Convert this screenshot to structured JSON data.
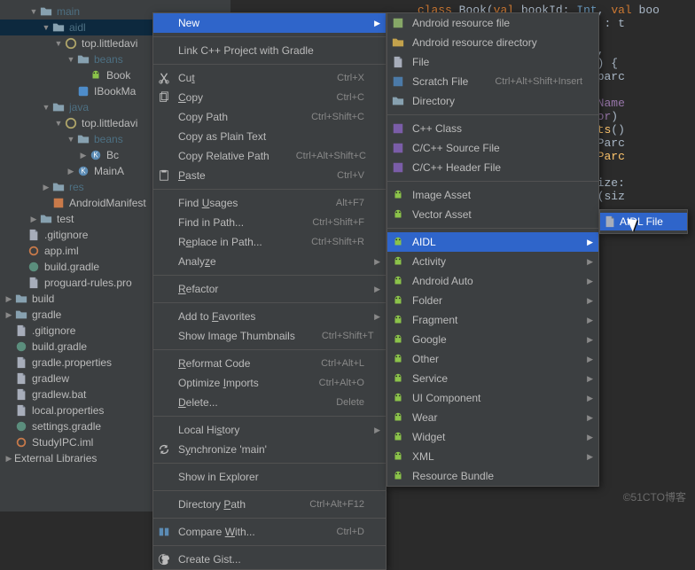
{
  "tree": {
    "items": [
      {
        "depth": 2,
        "chev": "down",
        "icon": "folder",
        "label": "main",
        "cls": "hl"
      },
      {
        "depth": 3,
        "chev": "down",
        "icon": "folder",
        "label": "aidl",
        "cls": "hl",
        "sel": true
      },
      {
        "depth": 4,
        "chev": "down",
        "icon": "package",
        "label": "top.littledavi"
      },
      {
        "depth": 5,
        "chev": "down",
        "icon": "folder",
        "label": "beans",
        "cls": "hl"
      },
      {
        "depth": 6,
        "chev": "",
        "icon": "android",
        "label": "Book"
      },
      {
        "depth": 5,
        "chev": "",
        "icon": "aidl",
        "label": "IBookMa"
      },
      {
        "depth": 3,
        "chev": "down",
        "icon": "folder",
        "label": "java",
        "cls": "hl"
      },
      {
        "depth": 4,
        "chev": "down",
        "icon": "package",
        "label": "top.littledavi"
      },
      {
        "depth": 5,
        "chev": "down",
        "icon": "folder",
        "label": "beans",
        "cls": "hl"
      },
      {
        "depth": 6,
        "chev": "right",
        "icon": "class",
        "label": "Bc"
      },
      {
        "depth": 5,
        "chev": "right",
        "icon": "class",
        "label": "MainA"
      },
      {
        "depth": 3,
        "chev": "right",
        "icon": "folder",
        "label": "res",
        "cls": "hl"
      },
      {
        "depth": 3,
        "chev": "",
        "icon": "manifest",
        "label": "AndroidManifest"
      },
      {
        "depth": 2,
        "chev": "right",
        "icon": "folder",
        "label": "test",
        "cls": ""
      },
      {
        "depth": 1,
        "chev": "",
        "icon": "file",
        "label": ".gitignore"
      },
      {
        "depth": 1,
        "chev": "",
        "icon": "ring",
        "label": "app.iml"
      },
      {
        "depth": 1,
        "chev": "",
        "icon": "gradle",
        "label": "build.gradle"
      },
      {
        "depth": 1,
        "chev": "",
        "icon": "file",
        "label": "proguard-rules.pro"
      },
      {
        "depth": 0,
        "chev": "right",
        "icon": "folder",
        "label": "build",
        "cls": ""
      },
      {
        "depth": 0,
        "chev": "right",
        "icon": "folder",
        "label": "gradle",
        "cls": ""
      },
      {
        "depth": 0,
        "chev": "",
        "icon": "file",
        "label": ".gitignore"
      },
      {
        "depth": 0,
        "chev": "",
        "icon": "gradle",
        "label": "build.gradle"
      },
      {
        "depth": 0,
        "chev": "",
        "icon": "file",
        "label": "gradle.properties"
      },
      {
        "depth": 0,
        "chev": "",
        "icon": "file",
        "label": "gradlew"
      },
      {
        "depth": 0,
        "chev": "",
        "icon": "file",
        "label": "gradlew.bat"
      },
      {
        "depth": 0,
        "chev": "",
        "icon": "file",
        "label": "local.properties"
      },
      {
        "depth": 0,
        "chev": "",
        "icon": "gradle",
        "label": "settings.gradle"
      },
      {
        "depth": 0,
        "chev": "",
        "icon": "ring",
        "label": "StudyIPC.iml"
      }
    ],
    "footer": "External Libraries"
  },
  "menu1": {
    "groups": [
      [
        {
          "label": "New",
          "sub": true,
          "hover": true
        }
      ],
      [
        {
          "label": "Link C++ Project with Gradle"
        }
      ],
      [
        {
          "icon": "cut",
          "label": "Cut",
          "shortcut": "Ctrl+X",
          "u": 2
        },
        {
          "icon": "copy",
          "label": "Copy",
          "shortcut": "Ctrl+C",
          "u": 0
        },
        {
          "label": "Copy Path",
          "shortcut": "Ctrl+Shift+C"
        },
        {
          "label": "Copy as Plain Text"
        },
        {
          "label": "Copy Relative Path",
          "shortcut": "Ctrl+Alt+Shift+C"
        },
        {
          "icon": "paste",
          "label": "Paste",
          "shortcut": "Ctrl+V",
          "u": 0
        }
      ],
      [
        {
          "label": "Find Usages",
          "shortcut": "Alt+F7",
          "u": 5
        },
        {
          "label": "Find in Path...",
          "shortcut": "Ctrl+Shift+F"
        },
        {
          "label": "Replace in Path...",
          "shortcut": "Ctrl+Shift+R",
          "u": 1
        },
        {
          "label": "Analyze",
          "sub": true,
          "u": 5
        }
      ],
      [
        {
          "label": "Refactor",
          "sub": true,
          "u": 0
        }
      ],
      [
        {
          "label": "Add to Favorites",
          "sub": true,
          "u": 7
        },
        {
          "label": "Show Image Thumbnails",
          "shortcut": "Ctrl+Shift+T"
        }
      ],
      [
        {
          "label": "Reformat Code",
          "shortcut": "Ctrl+Alt+L",
          "u": 0
        },
        {
          "label": "Optimize Imports",
          "shortcut": "Ctrl+Alt+O",
          "u": 9
        },
        {
          "label": "Delete...",
          "shortcut": "Delete",
          "u": 0
        }
      ],
      [
        {
          "label": "Local History",
          "sub": true,
          "u": 8
        },
        {
          "icon": "sync",
          "label": "Synchronize 'main'",
          "u": 1
        }
      ],
      [
        {
          "label": "Show in Explorer"
        }
      ],
      [
        {
          "label": "Directory Path",
          "shortcut": "Ctrl+Alt+F12",
          "u": 10
        }
      ],
      [
        {
          "icon": "diff",
          "label": "Compare With...",
          "shortcut": "Ctrl+D",
          "u": 8
        }
      ],
      [
        {
          "icon": "github",
          "label": "Create Gist..."
        }
      ]
    ]
  },
  "menu2": {
    "groups": [
      [
        {
          "icon": "xml",
          "label": "Android resource file"
        },
        {
          "icon": "resfolder",
          "label": "Android resource directory"
        },
        {
          "icon": "file",
          "label": "File"
        },
        {
          "icon": "scratch",
          "label": "Scratch File",
          "shortcut": "Ctrl+Alt+Shift+Insert"
        },
        {
          "icon": "folder",
          "label": "Directory"
        }
      ],
      [
        {
          "icon": "cpp",
          "label": "C++ Class"
        },
        {
          "icon": "cpp",
          "label": "C/C++ Source File"
        },
        {
          "icon": "cpp",
          "label": "C/C++ Header File"
        }
      ],
      [
        {
          "icon": "android",
          "label": "Image Asset"
        },
        {
          "icon": "android",
          "label": "Vector Asset"
        }
      ],
      [
        {
          "icon": "android",
          "label": "AIDL",
          "sub": true,
          "hover": true
        },
        {
          "icon": "android",
          "label": "Activity",
          "sub": true
        },
        {
          "icon": "android",
          "label": "Android Auto",
          "sub": true
        },
        {
          "icon": "android",
          "label": "Folder",
          "sub": true
        },
        {
          "icon": "android",
          "label": "Fragment",
          "sub": true
        },
        {
          "icon": "android",
          "label": "Google",
          "sub": true
        },
        {
          "icon": "android",
          "label": "Other",
          "sub": true
        },
        {
          "icon": "android",
          "label": "Service",
          "sub": true
        },
        {
          "icon": "android",
          "label": "UI Component",
          "sub": true
        },
        {
          "icon": "android",
          "label": "Wear",
          "sub": true
        },
        {
          "icon": "android",
          "label": "Widget",
          "sub": true
        },
        {
          "icon": "android",
          "label": "XML",
          "sub": true
        },
        {
          "icon": "android",
          "label": "Resource Bundle"
        }
      ]
    ]
  },
  "flyout": {
    "items": [
      {
        "label": "AIDL File",
        "hover": true
      }
    ]
  },
  "editor": {
    "lines": [
      [
        {
          "t": "                          ",
          "c": ""
        },
        {
          "t": "class",
          "c": "kw"
        },
        {
          "t": " Book(",
          "c": ""
        },
        {
          "t": "val",
          "c": "kw"
        },
        {
          "t": " bookId: ",
          "c": ""
        },
        {
          "t": "Int",
          "c": "ty"
        },
        {
          "t": ", ",
          "c": ""
        },
        {
          "t": "val",
          "c": "kw"
        },
        {
          "t": " boo",
          "c": ""
        }
      ],
      [
        {
          "t": "                                           : Parcel) : t",
          "c": ""
        }
      ],
      [
        {
          "t": "                                           dInt(),",
          "c": ""
        }
      ],
      [
        {
          "t": "                                           dString(),",
          "c": ""
        }
      ],
      [
        {
          "t": "                                           dString()) {",
          "c": ""
        }
      ],
      [
        {
          "t": "",
          "c": ""
        }
      ],
      [
        {
          "t": "",
          "c": ""
        }
      ],
      [
        {
          "t": "                                           ",
          "c": ""
        },
        {
          "t": "ToParcel",
          "c": "fn"
        },
        {
          "t": "(parc",
          "c": ""
        }
      ],
      [
        {
          "t": "                                           t(",
          "c": ""
        },
        {
          "t": "bookId",
          "c": "id"
        },
        {
          "t": ")",
          "c": ""
        }
      ],
      [
        {
          "t": "                                           ring(",
          "c": ""
        },
        {
          "t": "bookName",
          "c": "id"
        }
      ],
      [
        {
          "t": "                                           ring(",
          "c": ""
        },
        {
          "t": "author",
          "c": "id"
        },
        {
          "t": ")",
          "c": ""
        }
      ],
      [
        {
          "t": "",
          "c": ""
        }
      ],
      [
        {
          "t": "",
          "c": ""
        }
      ],
      [
        {
          "t": "                                           ",
          "c": ""
        },
        {
          "t": "ibeContents",
          "c": "fn"
        },
        {
          "t": "()",
          "c": ""
        }
      ],
      [
        {
          "t": "",
          "c": ""
        }
      ],
      [
        {
          "t": "",
          "c": ""
        }
      ],
      [
        {
          "t": "",
          "c": ""
        }
      ],
      [
        {
          "t": "                                           ",
          "c": ""
        },
        {
          "t": "REATOR",
          "c": "id"
        },
        {
          "t": " : Parc",
          "c": ""
        }
      ],
      [
        {
          "t": "                                           ",
          "c": ""
        },
        {
          "t": "reateFromParc",
          "c": "fn"
        }
      ],
      [
        {
          "t": "                                           k(parcel)",
          "c": ""
        }
      ],
      [
        {
          "t": "",
          "c": ""
        }
      ],
      [
        {
          "t": "",
          "c": ""
        }
      ],
      [
        {
          "t": "                                           ",
          "c": ""
        },
        {
          "t": "ewArray",
          "c": "fn"
        },
        {
          "t": "(size:",
          "c": ""
        }
      ],
      [
        {
          "t": "                                           ",
          "c": ""
        },
        {
          "t": "ayOfNulls",
          "c": "fn"
        },
        {
          "t": "(siz",
          "c": ""
        }
      ]
    ]
  },
  "watermark": "©51CTO博客"
}
